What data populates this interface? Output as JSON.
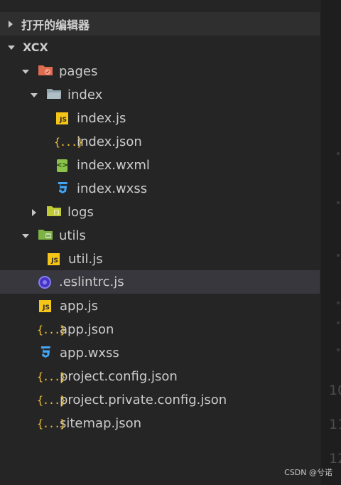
{
  "explorer": {
    "open_editors_label": "打开的编辑器",
    "project_label": "XCX",
    "tree": {
      "pages": "pages",
      "index_folder": "index",
      "index_js": "index.js",
      "index_json": "index.json",
      "index_wxml": "index.wxml",
      "index_wxss": "index.wxss",
      "logs": "logs",
      "utils": "utils",
      "util_js": "util.js",
      "eslintrc": ".eslintrc.js",
      "app_js": "app.js",
      "app_json": "app.json",
      "app_wxss": "app.wxss",
      "project_config": "project.config.json",
      "project_private_config": "project.private.config.json",
      "sitemap": "sitemap.json"
    }
  },
  "icons": {
    "js_text": "JS",
    "json_text": "{...}",
    "wxml_text": "<>"
  },
  "gutter": {
    "line_a": "10",
    "line_b": "11",
    "line_c": "12"
  },
  "watermark": "CSDN @兮诺",
  "colors": {
    "panel_bg": "#252526",
    "selected_bg": "#37373d",
    "js_yellow": "#f5c518",
    "json_yellow": "#f1c232",
    "css_blue": "#42a5f5",
    "wxml_green": "#8bc34a",
    "folder_red": "#e06c4f",
    "folder_gray": "#90a4ae",
    "folder_yellowgreen": "#c0ca33",
    "folder_green": "#7cb342"
  }
}
